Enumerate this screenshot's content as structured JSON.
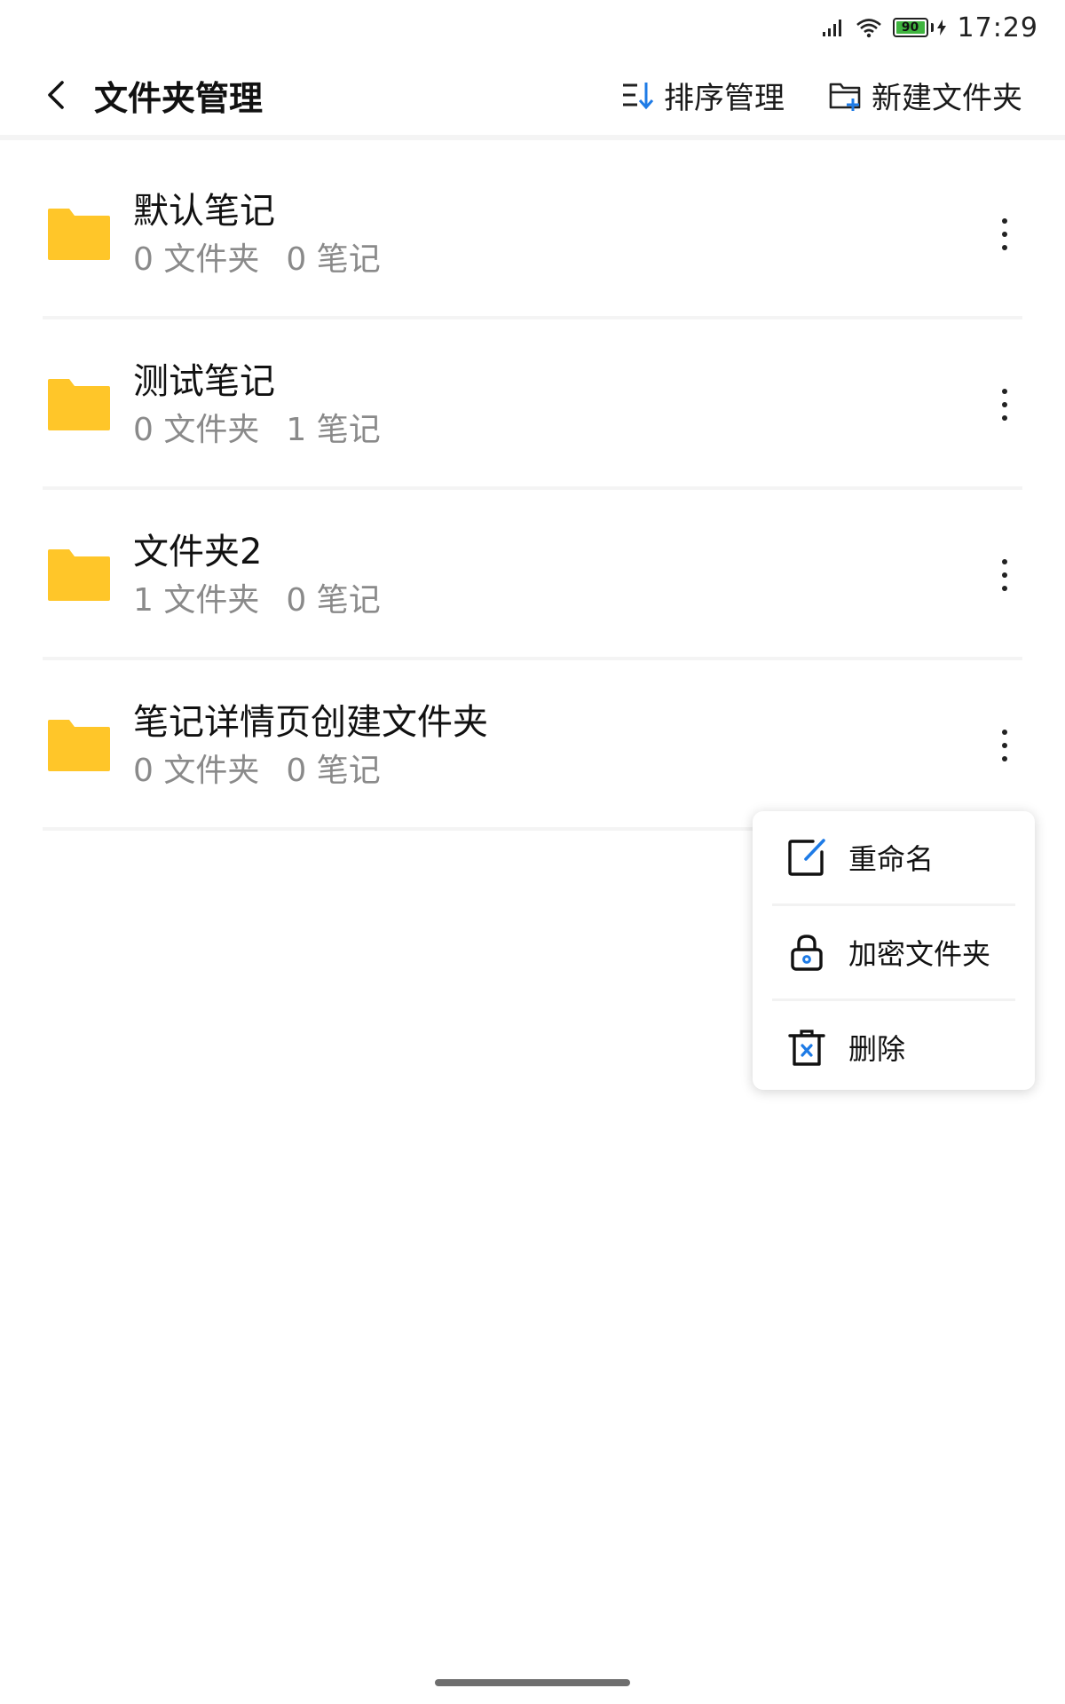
{
  "status_bar": {
    "battery_level": "90",
    "time": "17:29"
  },
  "header": {
    "title": "文件夹管理",
    "sort_label": "排序管理",
    "new_folder_label": "新建文件夹"
  },
  "folders": [
    {
      "name": "默认笔记",
      "folders": "0 文件夹",
      "notes": "0 笔记"
    },
    {
      "name": "测试笔记",
      "folders": "0 文件夹",
      "notes": "1 笔记"
    },
    {
      "name": "文件夹2",
      "folders": "1 文件夹",
      "notes": "0 笔记"
    },
    {
      "name": "笔记详情页创建文件夹",
      "folders": "0 文件夹",
      "notes": "0 笔记"
    }
  ],
  "context_menu": {
    "rename": "重命名",
    "encrypt": "加密文件夹",
    "delete": "删除"
  },
  "colors": {
    "folder": "#FFC629",
    "accent_blue": "#1E7BE6",
    "battery_green": "#3FB43F"
  },
  "icons": {
    "back": "chevron-left-icon",
    "sort": "sort-icon",
    "new_folder": "folder-plus-icon",
    "folder": "folder-icon",
    "more": "more-vertical-icon",
    "rename": "edit-icon",
    "encrypt": "lock-icon",
    "delete": "trash-icon"
  }
}
